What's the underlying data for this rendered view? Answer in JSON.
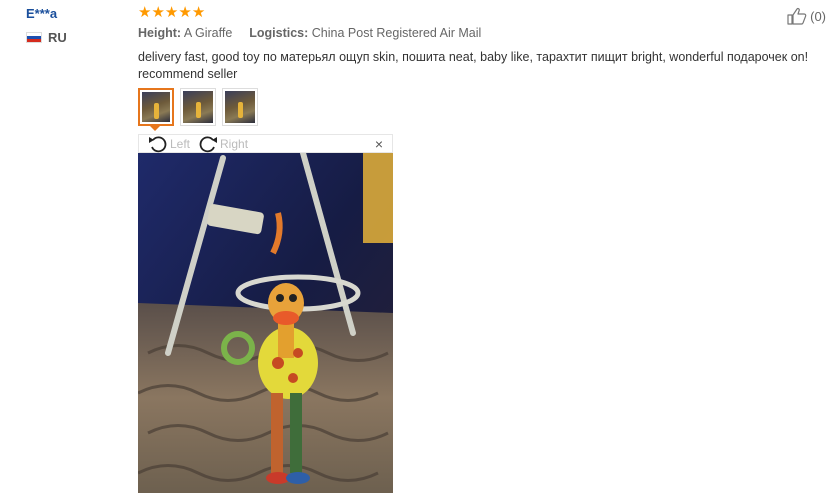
{
  "reviewer": {
    "name": "E***a",
    "country": "RU"
  },
  "review": {
    "rating": 5,
    "height_label": "Height:",
    "height_value": "A Giraffe",
    "logistics_label": "Logistics:",
    "logistics_value": "China Post Registered Air Mail",
    "text": "delivery fast, good toy по матерьял ощуп skin, пошита neat, baby like, тарахтит пищит bright, wonderful подарочек on! recommend seller"
  },
  "helpful": {
    "count": "(0)"
  },
  "viewer": {
    "left_label": "Left",
    "right_label": "Right",
    "close": "×"
  },
  "icons": {
    "like": "thumbs-up-icon",
    "rotate_left": "rotate-left-icon",
    "rotate_right": "rotate-right-icon",
    "close": "close-icon"
  },
  "colors": {
    "star": "#ff9900",
    "name": "#1a4f9c",
    "active_thumb": "#e6761c"
  }
}
